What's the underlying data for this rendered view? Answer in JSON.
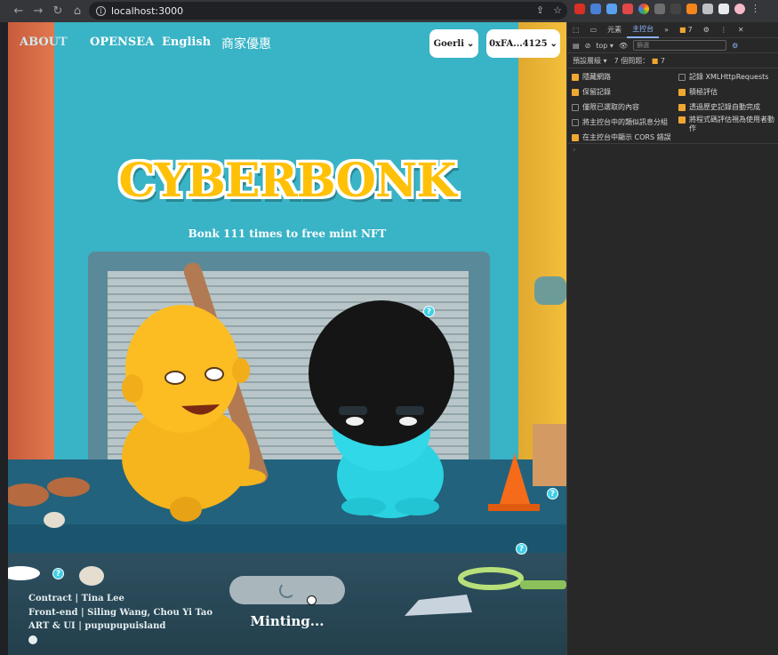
{
  "browser": {
    "url": "localhost:3000"
  },
  "site": {
    "nav": {
      "about": "ABOUT",
      "opensea": "OPENSEA",
      "language": "English",
      "merchant": "商家優惠"
    },
    "network": "Goerli",
    "wallet": "0xFA...4125",
    "title": "CYBERBONK",
    "subtitle": "Bonk 111 times to free mint NFT",
    "credits": [
      "Contract | Tina Lee",
      "Front-end | Siling Wang, Chou Yi Tao",
      "ART & UI | pupupupuisland"
    ],
    "status": "Minting..."
  },
  "devtools": {
    "tabs": [
      "元素",
      "主控台"
    ],
    "active_tab": "主控台",
    "issues_badge": "7",
    "context": "top",
    "filter_placeholder": "篩選",
    "levels": "預設層級",
    "issues_label": "7 個問題：",
    "issues_count": "7",
    "options_left": [
      {
        "label": "隱藏網路",
        "checked": true
      },
      {
        "label": "保留記錄",
        "checked": true
      },
      {
        "label": "僅限已選取的內容",
        "checked": false
      },
      {
        "label": "將主控台中的類似訊息分組",
        "checked": false
      },
      {
        "label": "在主控台中顯示 CORS 錯誤",
        "checked": true
      }
    ],
    "options_right": [
      {
        "label": "記錄 XMLHttpRequests",
        "checked": false
      },
      {
        "label": "積極評估",
        "checked": true
      },
      {
        "label": "透過歷史記錄自動完成",
        "checked": true
      },
      {
        "label": "將程式碼評估視為使用者動作",
        "checked": true
      }
    ],
    "prompt": "›"
  }
}
